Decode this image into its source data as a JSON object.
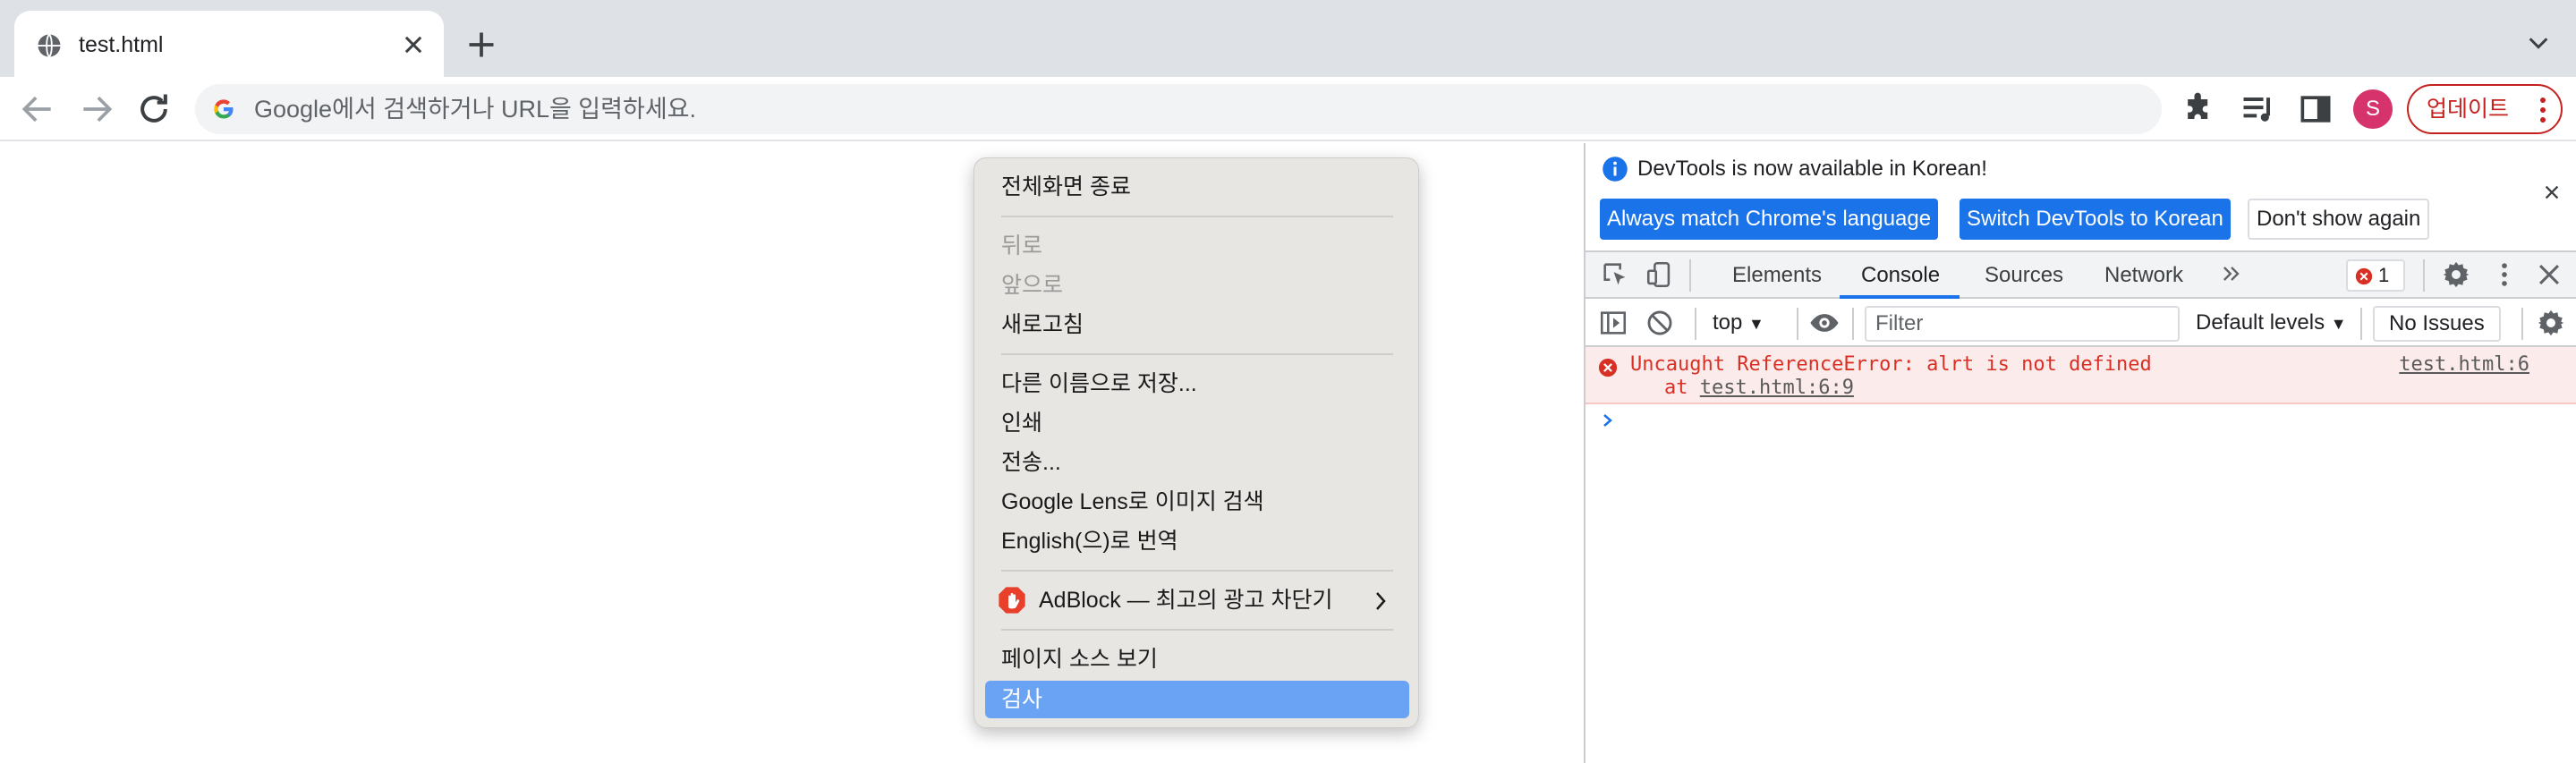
{
  "browser": {
    "tab": {
      "title": "test.html"
    },
    "omnibox": {
      "placeholder": "Google에서 검색하거나 URL을 입력하세요."
    },
    "avatar_letter": "S",
    "update_button": "업데이트"
  },
  "context_menu": {
    "exit_fullscreen": "전체화면 종료",
    "back": "뒤로",
    "forward": "앞으로",
    "reload": "새로고침",
    "save_as": "다른 이름으로 저장...",
    "print": "인쇄",
    "cast": "전송...",
    "google_lens": "Google Lens로 이미지 검색",
    "translate": "English(으)로 번역",
    "adblock": "AdBlock — 최고의 광고 차단기",
    "view_source": "페이지 소스 보기",
    "inspect": "검사"
  },
  "devtools": {
    "info_bar": {
      "message": "DevTools is now available in Korean!",
      "match_language": "Always match Chrome's language",
      "switch_korean": "Switch DevTools to Korean",
      "dont_show": "Don't show again"
    },
    "tabs": [
      "Elements",
      "Console",
      "Sources",
      "Network"
    ],
    "active_tab": "Console",
    "error_count": "1",
    "console_toolbar": {
      "context": "top",
      "filter_placeholder": "Filter",
      "levels": "Default levels",
      "issues": "No Issues"
    },
    "error": {
      "message": "Uncaught ReferenceError: alrt is not defined",
      "at_prefix": "at",
      "at_location": "test.html:6:9",
      "source": "test.html:6"
    }
  },
  "colors": {
    "accent": "#1a73e8",
    "error": "#d93025",
    "menu_highlight": "#6aa3f4",
    "update_red": "#c5221f"
  },
  "icons": [
    "globe-icon",
    "close-icon",
    "plus-icon",
    "chevron-down-icon",
    "back-arrow-icon",
    "forward-arrow-icon",
    "reload-icon",
    "google-logo-icon",
    "extensions-puzzle-icon",
    "media-queue-icon",
    "side-panel-icon",
    "more-vert-icon",
    "adblock-hand-icon",
    "chevron-right-icon",
    "info-icon",
    "inspect-element-icon",
    "device-toolbar-icon",
    "more-tabs-icon",
    "error-circle-icon",
    "settings-gear-icon",
    "sidebar-toggle-icon",
    "clear-console-icon",
    "eye-icon",
    "prompt-chevron-icon"
  ]
}
